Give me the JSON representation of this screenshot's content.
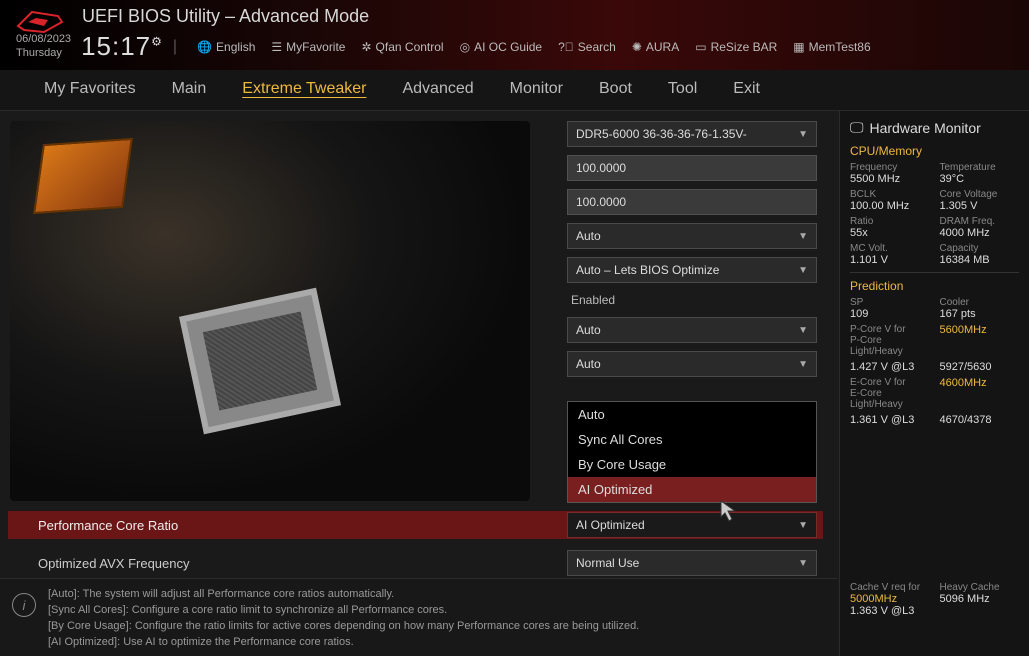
{
  "header": {
    "title": "UEFI BIOS Utility – Advanced Mode",
    "date": "06/08/2023",
    "day": "Thursday",
    "time": "15:17"
  },
  "toolbar": {
    "language": "English",
    "myfavorite": "MyFavorite",
    "qfan": "Qfan Control",
    "aioc": "AI OC Guide",
    "search": "Search",
    "aura": "AURA",
    "resize": "ReSize BAR",
    "memtest": "MemTest86"
  },
  "tabs": [
    "My Favorites",
    "Main",
    "Extreme Tweaker",
    "Advanced",
    "Monitor",
    "Boot",
    "Tool",
    "Exit"
  ],
  "active_tab": "Extreme Tweaker",
  "settings": {
    "xmp": "DDR5-6000 36-36-36-76-1.35V-",
    "val1": "100.0000",
    "val2": "100.0000",
    "auto1": "Auto",
    "bios_opt": "Auto – Lets BIOS Optimize",
    "enabled_label": "Enabled",
    "auto2": "Auto",
    "auto3": "Auto"
  },
  "dropdown": {
    "items": [
      "Auto",
      "Sync All Cores",
      "By Core Usage",
      "AI Optimized"
    ],
    "hover": "AI Optimized"
  },
  "rows": {
    "perf_core": {
      "label": "Performance Core Ratio",
      "value": "AI Optimized"
    },
    "avx": {
      "label": "Optimized AVX Frequency",
      "value": "Normal Use"
    }
  },
  "help": {
    "lines": [
      "[Auto]: The system will adjust all Performance core ratios automatically.",
      "[Sync All Cores]: Configure a core ratio limit to synchronize all Performance cores.",
      "[By Core Usage]: Configure the ratio limits for active cores depending on how many Performance cores are being utilized.",
      "[AI Optimized]: Use AI to optimize the Performance core ratios."
    ]
  },
  "monitor": {
    "title": "Hardware Monitor",
    "cpu_section": "CPU/Memory",
    "frequency_label": "Frequency",
    "frequency": "5500 MHz",
    "temp_label": "Temperature",
    "temp": "39°C",
    "bclk_label": "BCLK",
    "bclk": "100.00 MHz",
    "vcore_label": "Core Voltage",
    "vcore": "1.305 V",
    "ratio_label": "Ratio",
    "ratio": "55x",
    "dram_label": "DRAM Freq.",
    "dram": "4000 MHz",
    "mcvolt_label": "MC Volt.",
    "mcvolt": "1.101 V",
    "cap_label": "Capacity",
    "cap": "16384 MB",
    "pred_section": "Prediction",
    "sp_label": "SP",
    "sp": "109",
    "cooler_label": "Cooler",
    "cooler": "167 pts",
    "pcorev_label": "P-Core V for",
    "pcorev_freq": "5600MHz",
    "pcorev": "1.427 V @L3",
    "pcorelh_label": "P-Core Light/Heavy",
    "pcorelh": "5927/5630",
    "ecorev_label": "E-Core V for",
    "ecorev_freq": "4600MHz",
    "ecorev": "1.361 V @L3",
    "ecorelh_label": "E-Core Light/Heavy",
    "ecorelh": "4670/4378",
    "cachev_label": "Cache V req for",
    "cachev_freq": "5000MHz",
    "cachev": "1.363 V @L3",
    "heavycache_label": "Heavy Cache",
    "heavycache": "5096 MHz"
  }
}
